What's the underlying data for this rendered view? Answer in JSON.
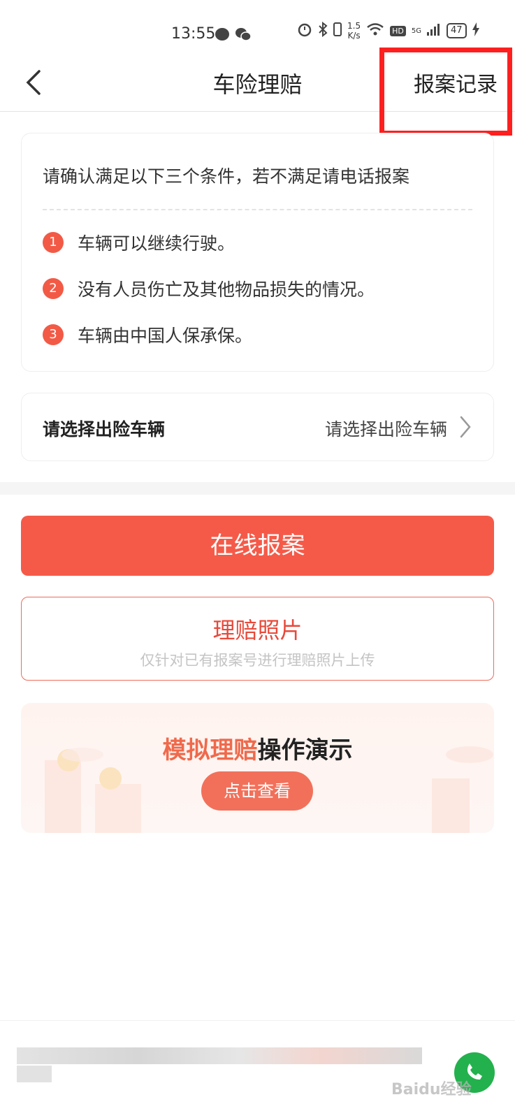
{
  "status_bar": {
    "time": "13:55",
    "net_speed_value": "1.5",
    "net_speed_unit": "K/s",
    "hd": "HD",
    "network": "5G",
    "battery": "47"
  },
  "nav": {
    "title": "车险理赔",
    "record_label": "报案记录",
    "highlight_color": "#ff1f1f"
  },
  "conditions": {
    "heading": "请确认满足以下三个条件，若不满足请电话报案",
    "items": [
      {
        "num": "1",
        "text": "车辆可以继续行驶。"
      },
      {
        "num": "2",
        "text": "没有人员伤亡及其他物品损失的情况。"
      },
      {
        "num": "3",
        "text": "车辆由中国人保承保。"
      }
    ]
  },
  "vehicle": {
    "label": "请选择出险车辆",
    "value": "请选择出险车辆"
  },
  "actions": {
    "report_label": "在线报案",
    "photo_title": "理赔照片",
    "photo_subtitle": "仅针对已有报案号进行理赔照片上传"
  },
  "demo": {
    "title_highlight": "模拟理赔",
    "title_rest": "操作演示",
    "button_label": "点击查看"
  },
  "footer": {
    "watermark": "Baidu经验"
  },
  "colors": {
    "accent": "#f55a48",
    "number_badge": "#f25a46",
    "phone_button": "#23b14d"
  },
  "icons": {
    "back": "chevron-left-icon",
    "arrow": "chevron-right-icon",
    "phone": "phone-icon"
  }
}
